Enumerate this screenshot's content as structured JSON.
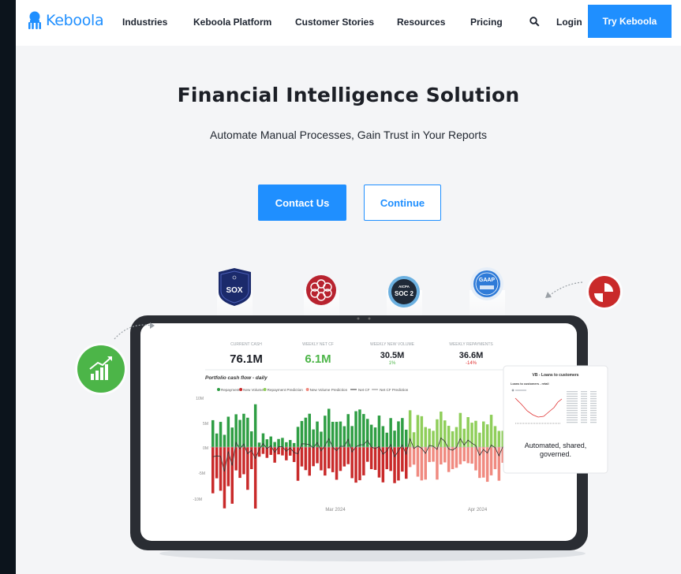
{
  "brand": {
    "name": "Keboola",
    "color": "#1f8fff"
  },
  "nav": {
    "items": [
      "Industries",
      "Keboola Platform",
      "Customer Stories",
      "Resources",
      "Pricing"
    ],
    "login": "Login",
    "cta": "Try Keboola",
    "search_icon": "search-icon"
  },
  "hero": {
    "title": "Financial Intelligence Solution",
    "subtitle": "Automate Manual Processes, Gain Trust in Your Reports",
    "primary_button": "Contact Us",
    "secondary_button": "Continue"
  },
  "badges": {
    "sox": "SOX",
    "soc_top": "AICPA",
    "soc_main": "SOC 2",
    "gaap": "GAAP"
  },
  "dashboard": {
    "kpis": [
      {
        "label": "CURRENT CASH",
        "value": "76.1M",
        "delta": "",
        "color": "#1c1f26"
      },
      {
        "label": "WEEKLY NET CF",
        "value": "6.1M",
        "delta": "",
        "color": "#4cb548"
      },
      {
        "label": "WEEKLY NEW VOLUME",
        "value": "30.5M",
        "delta": "1%",
        "color": "#1c1f26"
      },
      {
        "label": "WEEKLY REPAYMENTS",
        "value": "36.6M",
        "delta": "-14%",
        "color": "#1c1f26"
      }
    ],
    "chart_title": "Portfolio cash flow - daily",
    "legend": [
      "Repayment",
      "New Volume",
      "Repayment Prediction",
      "New Volume Prediction",
      "Net CF",
      "Net CF Prediction"
    ],
    "legend_colors": [
      "#2f9e44",
      "#c92a2a",
      "#8fce5a",
      "#f08a80",
      "#333333",
      "#888888"
    ],
    "y_ticks": [
      "10M",
      "5M",
      "0M",
      "-5M",
      "-10M"
    ],
    "x_ticks": [
      "Mar 2024",
      "Apr 2024"
    ]
  },
  "side_card": {
    "title": "VB - Loans to customers",
    "subtitle": "Loans to customers - retail",
    "caption": "Automated, shared, governed."
  }
}
